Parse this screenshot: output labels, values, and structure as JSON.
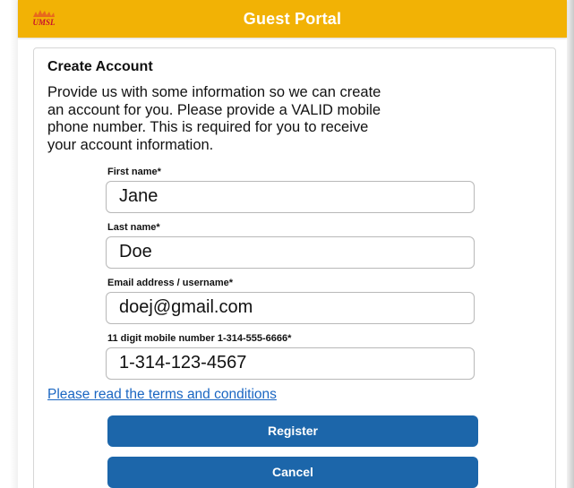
{
  "header": {
    "logo_text": "UMSL",
    "title": "Guest Portal",
    "color": "#f2b205"
  },
  "panel": {
    "title": "Create Account",
    "intro_lines": [
      "Provide us with some information so we can create",
      "an account for you. Please provide a VALID mobile",
      "phone number.  This is required for you to receive",
      "your account information."
    ]
  },
  "form": {
    "first_name": {
      "label": "First name*",
      "value": "Jane"
    },
    "last_name": {
      "label": "Last name*",
      "value": "Doe"
    },
    "email": {
      "label": "Email address / username*",
      "value": "doej@gmail.com"
    },
    "mobile": {
      "label": "11 digit mobile number 1-314-555-6666*",
      "value": "1-314-123-4567"
    }
  },
  "terms_link": "Please read the terms and conditions",
  "buttons": {
    "register": "Register",
    "cancel": "Cancel",
    "color": "#1c66aa"
  },
  "icons": {
    "logo": "umsl-logo-icon"
  }
}
